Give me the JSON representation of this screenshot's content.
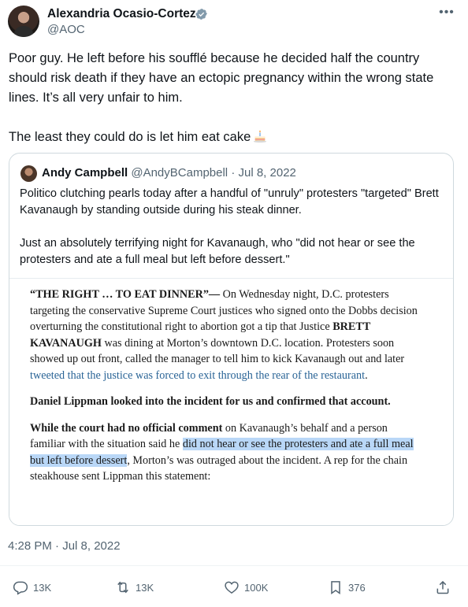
{
  "author": {
    "name": "Alexandria Ocasio-Cortez",
    "handle": "@AOC"
  },
  "tweet": {
    "paragraph1": "Poor guy. He left before his soufflé because he decided half the country should risk death if they have an ectopic pregnancy within the wrong state lines. It’s all very unfair to him.",
    "paragraph2": "The least they could do is let him eat cake",
    "emoji": "cake-icon",
    "timestamp": "4:28 PM · Jul 8, 2022"
  },
  "quote": {
    "name": "Andy Campbell",
    "handle": "@AndyBCampbell",
    "separator": "·",
    "date": "Jul 8, 2022",
    "paragraph1": "Politico clutching pearls today after a handful of \"unruly\" protesters \"targeted\" Brett Kavanaugh by standing outside during his steak dinner.",
    "paragraph2": "Just an absolutely terrifying night for Kavanaugh, who \"did not hear or see the protesters and ate a full meal but left before dessert.\""
  },
  "article": {
    "p1_lead": "“THE RIGHT … TO EAT DINNER”—",
    "p1_a": " On Wednesday night, D.C. protesters targeting the conservative Supreme Court justices who signed onto the Dobbs decision overturning the constitutional right to abortion got a tip that Justice ",
    "p1_name": "BRETT KAVANAUGH",
    "p1_b": " was dining at Morton’s downtown D.C. location. Protesters soon showed up out front, called the manager to tell him to kick Kavanaugh out and later ",
    "p1_link": "tweeted that the justice was forced to exit through the rear of the restaurant",
    "p1_end": ".",
    "p2": "Daniel Lippman looked into the incident for us and confirmed that account.",
    "p3_lead": "While the court had no official comment",
    "p3_a": " on Kavanaugh’s behalf and a person familiar with the situation said he ",
    "p3_highlight": "did not hear or see the protesters and ate a full meal but left before dessert",
    "p3_b": ", Morton’s was outraged about the incident. A rep for the chain steakhouse sent Lippman this statement:",
    "highlight_color": "#b9d7f7",
    "link_color": "#2a6496"
  },
  "actions": {
    "replies": "13K",
    "reposts": "13K",
    "likes": "100K",
    "bookmarks": "376"
  },
  "colors": {
    "text": "#0f1419",
    "secondary": "#536471",
    "verified": "#829aab",
    "border": "#cfd9de"
  },
  "icons": {
    "more": "more-dots-icon",
    "verified": "verified-badge-icon",
    "reply": "reply-icon",
    "repost": "repost-icon",
    "like": "heart-icon",
    "bookmark": "bookmark-icon",
    "share": "share-icon"
  }
}
